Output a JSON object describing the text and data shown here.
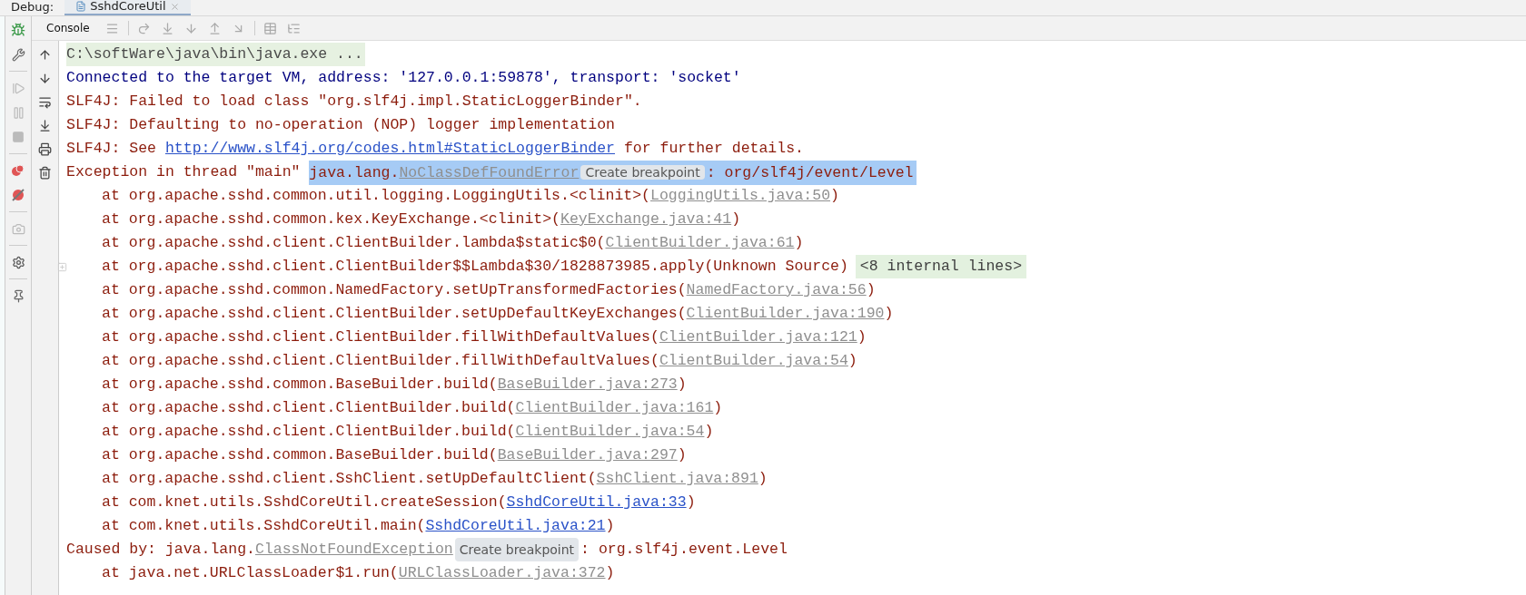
{
  "debug_label": "Debug:",
  "tabs": [
    {
      "label": "SshdCoreUtil",
      "selected": true,
      "closable": true
    }
  ],
  "console_tabs": [
    {
      "label": "Console",
      "selected": true
    }
  ],
  "lines": [
    {
      "kind": "command",
      "segments": [
        {
          "kind": "text",
          "text": "C:\\softWare\\java\\bin\\java.exe ..."
        }
      ]
    },
    {
      "kind": "info",
      "segments": [
        {
          "kind": "text",
          "text": "Connected to the target VM, address: '127.0.0.1:59878', transport: 'socket'"
        }
      ]
    },
    {
      "kind": "error",
      "segments": [
        {
          "kind": "text",
          "text": "SLF4J: Failed to load class \"org.slf4j.impl.StaticLoggerBinder\"."
        }
      ]
    },
    {
      "kind": "error",
      "segments": [
        {
          "kind": "text",
          "text": "SLF4J: Defaulting to no-operation (NOP) logger implementation"
        }
      ]
    },
    {
      "kind": "error",
      "segments": [
        {
          "kind": "text",
          "text": "SLF4J: See "
        },
        {
          "kind": "url",
          "text": "http://www.slf4j.org/codes.html#StaticLoggerBinder"
        },
        {
          "kind": "text",
          "text": " for further details."
        }
      ]
    },
    {
      "kind": "error",
      "segments": [
        {
          "kind": "text",
          "text": "Exception in thread \"main\" "
        },
        {
          "kind": "selection",
          "segments": [
            {
              "kind": "text",
              "text": "java.lang."
            },
            {
              "kind": "link",
              "text": "NoClassDefFoundError",
              "project": false
            },
            {
              "kind": "hint",
              "text": "Create breakpoint"
            },
            {
              "kind": "text",
              "text": ": org/slf4j/event/Level"
            }
          ]
        }
      ]
    },
    {
      "kind": "frame",
      "segments": [
        {
          "kind": "text",
          "text": "at org.apache.sshd.common.util.logging.LoggingUtils.<clinit>("
        },
        {
          "kind": "link",
          "text": "LoggingUtils.java:50",
          "project": false
        },
        {
          "kind": "text",
          "text": ")"
        }
      ]
    },
    {
      "kind": "frame",
      "segments": [
        {
          "kind": "text",
          "text": "at org.apache.sshd.common.kex.KeyExchange.<clinit>("
        },
        {
          "kind": "link",
          "text": "KeyExchange.java:41",
          "project": false
        },
        {
          "kind": "text",
          "text": ")"
        }
      ]
    },
    {
      "kind": "frame",
      "segments": [
        {
          "kind": "text",
          "text": "at org.apache.sshd.client.ClientBuilder.lambda$static$0("
        },
        {
          "kind": "link",
          "text": "ClientBuilder.java:61",
          "project": false
        },
        {
          "kind": "text",
          "text": ")"
        }
      ]
    },
    {
      "kind": "frame",
      "segments": [
        {
          "kind": "text",
          "text": "at org.apache.sshd.client.ClientBuilder$$Lambda$30/1828873985.apply(Unknown Source)"
        },
        {
          "kind": "folded",
          "text": "<8 internal lines>"
        }
      ]
    },
    {
      "kind": "frame",
      "segments": [
        {
          "kind": "text",
          "text": "at org.apache.sshd.common.NamedFactory.setUpTransformedFactories("
        },
        {
          "kind": "link",
          "text": "NamedFactory.java:56",
          "project": false
        },
        {
          "kind": "text",
          "text": ")"
        }
      ]
    },
    {
      "kind": "frame",
      "segments": [
        {
          "kind": "text",
          "text": "at org.apache.sshd.client.ClientBuilder.setUpDefaultKeyExchanges("
        },
        {
          "kind": "link",
          "text": "ClientBuilder.java:190",
          "project": false
        },
        {
          "kind": "text",
          "text": ")"
        }
      ]
    },
    {
      "kind": "frame",
      "segments": [
        {
          "kind": "text",
          "text": "at org.apache.sshd.client.ClientBuilder.fillWithDefaultValues("
        },
        {
          "kind": "link",
          "text": "ClientBuilder.java:121",
          "project": false
        },
        {
          "kind": "text",
          "text": ")"
        }
      ]
    },
    {
      "kind": "frame",
      "segments": [
        {
          "kind": "text",
          "text": "at org.apache.sshd.client.ClientBuilder.fillWithDefaultValues("
        },
        {
          "kind": "link",
          "text": "ClientBuilder.java:54",
          "project": false
        },
        {
          "kind": "text",
          "text": ")"
        }
      ]
    },
    {
      "kind": "frame",
      "segments": [
        {
          "kind": "text",
          "text": "at org.apache.sshd.common.BaseBuilder.build("
        },
        {
          "kind": "link",
          "text": "BaseBuilder.java:273",
          "project": false
        },
        {
          "kind": "text",
          "text": ")"
        }
      ]
    },
    {
      "kind": "frame",
      "segments": [
        {
          "kind": "text",
          "text": "at org.apache.sshd.client.ClientBuilder.build("
        },
        {
          "kind": "link",
          "text": "ClientBuilder.java:161",
          "project": false
        },
        {
          "kind": "text",
          "text": ")"
        }
      ]
    },
    {
      "kind": "frame",
      "segments": [
        {
          "kind": "text",
          "text": "at org.apache.sshd.client.ClientBuilder.build("
        },
        {
          "kind": "link",
          "text": "ClientBuilder.java:54",
          "project": false
        },
        {
          "kind": "text",
          "text": ")"
        }
      ]
    },
    {
      "kind": "frame",
      "segments": [
        {
          "kind": "text",
          "text": "at org.apache.sshd.common.BaseBuilder.build("
        },
        {
          "kind": "link",
          "text": "BaseBuilder.java:297",
          "project": false
        },
        {
          "kind": "text",
          "text": ")"
        }
      ]
    },
    {
      "kind": "frame",
      "segments": [
        {
          "kind": "text",
          "text": "at org.apache.sshd.client.SshClient.setUpDefaultClient("
        },
        {
          "kind": "link",
          "text": "SshClient.java:891",
          "project": false
        },
        {
          "kind": "text",
          "text": ")"
        }
      ]
    },
    {
      "kind": "frame",
      "segments": [
        {
          "kind": "text",
          "text": "at com.knet.utils.SshdCoreUtil.createSession("
        },
        {
          "kind": "link",
          "text": "SshdCoreUtil.java:33",
          "project": true
        },
        {
          "kind": "text",
          "text": ")"
        }
      ]
    },
    {
      "kind": "frame",
      "segments": [
        {
          "kind": "text",
          "text": "at com.knet.utils.SshdCoreUtil.main("
        },
        {
          "kind": "link",
          "text": "SshdCoreUtil.java:21",
          "project": true
        },
        {
          "kind": "text",
          "text": ")"
        }
      ]
    },
    {
      "kind": "error",
      "segments": [
        {
          "kind": "text",
          "text": "Caused by: java.lang."
        },
        {
          "kind": "link",
          "text": "ClassNotFoundException",
          "project": false
        },
        {
          "kind": "hint",
          "text": "Create breakpoint"
        },
        {
          "kind": "text",
          "text": ": org.slf4j.event.Level"
        }
      ]
    },
    {
      "kind": "frame",
      "segments": [
        {
          "kind": "text",
          "text": "at java.net.URLClassLoader$1.run("
        },
        {
          "kind": "link",
          "text": "URLClassLoader.java:372",
          "project": false
        },
        {
          "kind": "text",
          "text": ")"
        }
      ]
    }
  ]
}
